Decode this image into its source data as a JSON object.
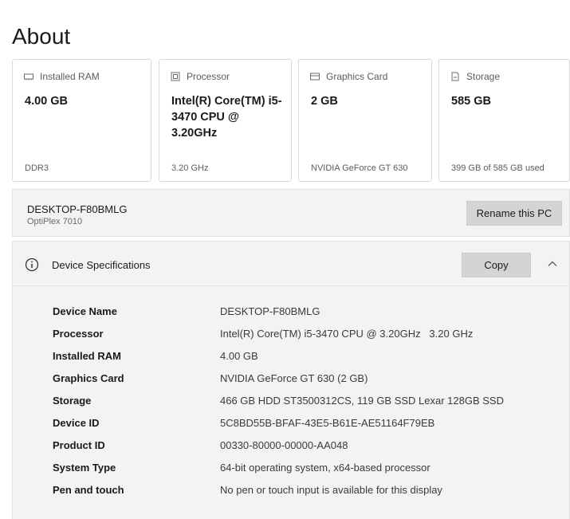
{
  "page": {
    "title": "About"
  },
  "cards": [
    {
      "label": "Installed RAM",
      "icon": "ram-icon",
      "value": "4.00 GB",
      "sub": "DDR3"
    },
    {
      "label": "Processor",
      "icon": "processor-icon",
      "value": "Intel(R) Core(TM) i5-3470 CPU @ 3.20GHz",
      "sub": "3.20 GHz"
    },
    {
      "label": "Graphics Card",
      "icon": "graphics-card-icon",
      "value": "2 GB",
      "sub": "NVIDIA GeForce GT 630"
    },
    {
      "label": "Storage",
      "icon": "storage-icon",
      "value": "585 GB",
      "sub": "399 GB of 585 GB used"
    }
  ],
  "pc": {
    "name": "DESKTOP-F80BMLG",
    "model": "OptiPlex 7010",
    "rename_label": "Rename this PC"
  },
  "specs": {
    "title": "Device Specifications",
    "copy_label": "Copy",
    "rows": [
      {
        "key": "Device Name",
        "value": "DESKTOP-F80BMLG"
      },
      {
        "key": "Processor",
        "value": "Intel(R) Core(TM) i5-3470 CPU @ 3.20GHz   3.20 GHz"
      },
      {
        "key": "Installed RAM",
        "value": "4.00 GB"
      },
      {
        "key": "Graphics Card",
        "value": "NVIDIA GeForce GT 630 (2 GB)"
      },
      {
        "key": "Storage",
        "value": "466 GB HDD ST3500312CS, 119 GB SSD Lexar 128GB SSD"
      },
      {
        "key": "Device ID",
        "value": "5C8BD55B-BFAF-43E5-B61E-AE51164F79EB"
      },
      {
        "key": "Product ID",
        "value": "00330-80000-00000-AA048"
      },
      {
        "key": "System Type",
        "value": "64-bit operating system, x64-based processor"
      },
      {
        "key": "Pen and touch",
        "value": "No pen or touch input is available for this display"
      }
    ]
  },
  "colors": {
    "card_border": "#d9d9d9",
    "panel_bg": "#f3f3f3",
    "button_bg": "#d4d4d4"
  }
}
